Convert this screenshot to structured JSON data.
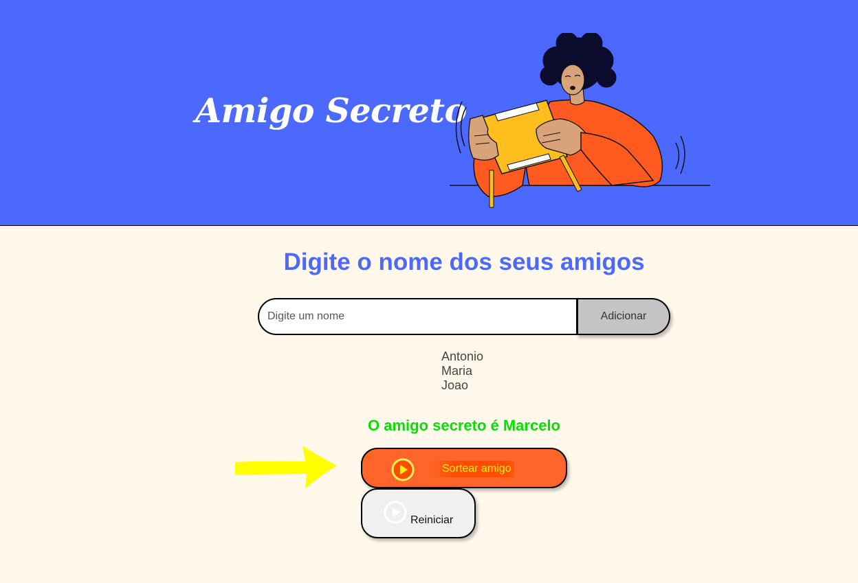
{
  "header": {
    "title": "Amigo Secreto",
    "illustration": "person-holding-gift-box-illustration"
  },
  "main": {
    "subtitle": "Digite o nome dos seus amigos",
    "input": {
      "placeholder": "Digite um nome",
      "value": ""
    },
    "add_button_label": "Adicionar",
    "friends": [
      "Antonio",
      "Maria",
      "Joao"
    ],
    "result": "O amigo secreto é Marcelo",
    "draw_button_label": "Sortear amigo",
    "reset_button_label": "Reiniciar"
  },
  "annotation": {
    "arrow_icon": "yellow-arrow-icon"
  },
  "colors": {
    "header_bg": "#4B69FD",
    "page_bg": "#FFF8EB",
    "subtitle": "#4B69FD",
    "result": "#05DF05",
    "draw_button": "#FE652B",
    "add_button": "#C4C4C4",
    "reset_button": "#F0F0F0",
    "arrow": "#FFFF00"
  },
  "icons": {
    "draw_button": "play-circle-icon",
    "reset_button": "play-circle-icon"
  }
}
